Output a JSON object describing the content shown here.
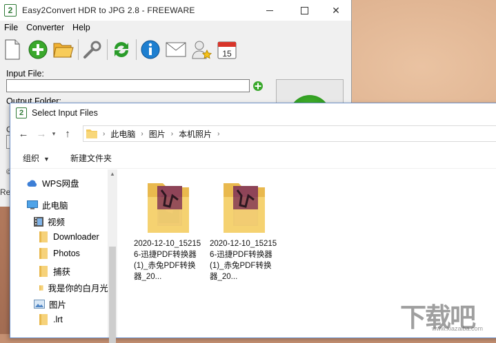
{
  "app": {
    "logo_text": "2",
    "title": "Easy2Convert HDR to JPG 2.8 - FREEWARE",
    "menu": [
      "File",
      "Converter",
      "Help"
    ],
    "input_label": "Input File:",
    "input_value": "",
    "output_label": "Output Folder:",
    "calendar_day": "15",
    "stub_c": "C",
    "stub_copy": "©",
    "stub_re": "Re"
  },
  "dialog": {
    "logo_text": "2",
    "title": "Select Input Files",
    "breadcrumb": [
      "此电脑",
      "图片",
      "本机照片"
    ],
    "organize_label": "组织",
    "new_folder_label": "新建文件夹",
    "tree": [
      {
        "label": "WPS网盘",
        "icon": "cloud-icon"
      },
      {
        "label": "此电脑",
        "icon": "computer-icon"
      },
      {
        "label": "视频",
        "icon": "video-folder-icon"
      },
      {
        "label": "Downloader",
        "icon": "folder-icon"
      },
      {
        "label": "Photos",
        "icon": "folder-icon"
      },
      {
        "label": "捕获",
        "icon": "folder-icon"
      },
      {
        "label": "我是你的白月光",
        "icon": "folder-icon"
      },
      {
        "label": "图片",
        "icon": "pictures-folder-icon"
      },
      {
        "label": ".lrt",
        "icon": "folder-icon"
      }
    ],
    "files": [
      {
        "name": "2020-12-10_152156-迅捷PDF转换器 (1)_赤兔PDF转换器_20..."
      },
      {
        "name": "2020-12-10_152156-迅捷PDF转换器 (1)_赤兔PDF转换器_20..."
      }
    ]
  },
  "watermark": {
    "text": "下载吧",
    "sub": "www.xiazaiba.com"
  }
}
